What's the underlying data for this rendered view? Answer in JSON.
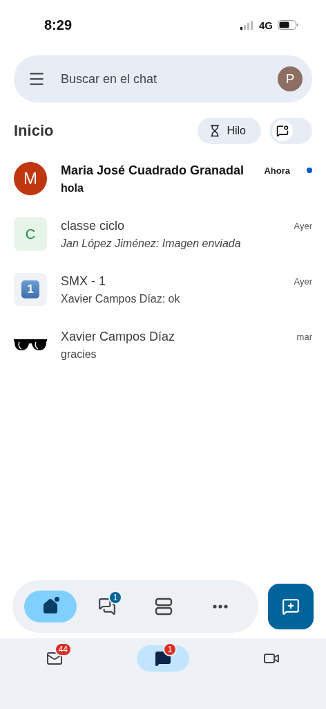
{
  "status_bar": {
    "time": "8:29",
    "network": "4G"
  },
  "search": {
    "placeholder": "Buscar en el chat",
    "avatar": "P"
  },
  "header": {
    "title": "Inicio",
    "chips": [
      {
        "kind": "threads",
        "label": "Hilo"
      },
      {
        "kind": "mentions"
      }
    ]
  },
  "chats": [
    {
      "avatar": {
        "kind": "circle",
        "text": "M",
        "color": "#c0360e"
      },
      "name": "Maria José Cuadrado Granadal",
      "time": "Ahora",
      "preview": "hola",
      "unread": true,
      "italic": false
    },
    {
      "avatar": {
        "kind": "square",
        "text": "C",
        "color": "#1e8e3e"
      },
      "name": "classe ciclo",
      "time": "Ayer",
      "preview": "Jan López Jiménez: Imagen enviada",
      "unread": false,
      "italic": true
    },
    {
      "avatar": {
        "kind": "keycap",
        "text": "1"
      },
      "name": "SMX - 1",
      "time": "Ayer",
      "preview": "Xavier Campos Díaz: ok",
      "unread": false,
      "italic": false
    },
    {
      "avatar": {
        "kind": "glasses"
      },
      "name": "Xavier Campos Díaz",
      "time": "mar",
      "preview": "gracies",
      "unread": false,
      "italic": false
    }
  ],
  "nav": {
    "items": [
      {
        "kind": "home",
        "selected": true,
        "dot": true
      },
      {
        "kind": "messages",
        "selected": false,
        "badge": "1"
      },
      {
        "kind": "spaces",
        "selected": false
      },
      {
        "kind": "more",
        "selected": false
      }
    ]
  },
  "tabs": [
    {
      "kind": "mail",
      "selected": false,
      "badge": "44"
    },
    {
      "kind": "chat",
      "selected": true,
      "badge": "1"
    },
    {
      "kind": "video",
      "selected": false
    }
  ]
}
